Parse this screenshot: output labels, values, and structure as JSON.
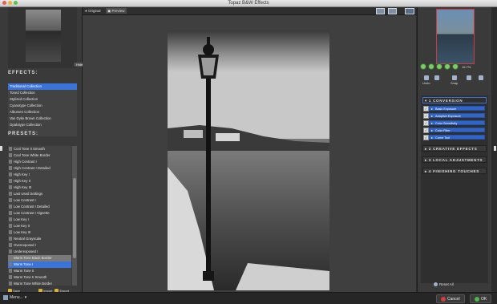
{
  "window": {
    "title": "Topaz B&W Effects"
  },
  "left_panel": {
    "hide_label": "Hide",
    "effects_title": "EFFECTS:",
    "effects": [
      "Traditional Collection",
      "Toned Collection",
      "Stylized Collection",
      "Cyanotype Collection",
      "Albumen Collection",
      "Van Dyke Brown Collection",
      "Opalotype Collection"
    ],
    "selected_effect_index": 0,
    "presets_title": "PRESETS:",
    "presets": [
      "Cool Tone II Smooth",
      "Cool Tone White Border",
      "High Contrast I",
      "High Contrast I Detailed",
      "High Key I",
      "High Key II",
      "High Key III",
      "Last Used Settings",
      "Low Contrast I",
      "Low Contrast I Detailed",
      "Low Contrast I Vignette",
      "Low Key I",
      "Low Key II",
      "Low Key III",
      "Neutral Grayscale",
      "Overexposed I",
      "Underexposed I",
      "Warm Tone Black Border",
      "Warm Tone I",
      "Warm Tone II",
      "Warm Tone II Smooth",
      "Warm Tone White Border"
    ],
    "grey_preset_index": 17,
    "selected_preset_index": 18,
    "bottom_buttons": [
      "Save",
      "Import",
      "Export"
    ]
  },
  "toolbar": {
    "original_label": "Original",
    "preview_label": "Preview"
  },
  "right_panel": {
    "zoom_text": "16.7%",
    "undo_label": "Undo",
    "snap_label": "Snap",
    "sections": [
      {
        "label": "1 CONVERSION",
        "open": true
      },
      {
        "label": "2 CREATIVE EFFECTS",
        "open": false
      },
      {
        "label": "3 LOCAL ADJUSTMENTS",
        "open": false
      },
      {
        "label": "4 FINISHING TOUCHES",
        "open": false
      }
    ],
    "conversion_items": [
      {
        "label": "Basic Exposure",
        "checked": true
      },
      {
        "label": "Adaptive Exposure",
        "checked": true
      },
      {
        "label": "Color Sensitivity",
        "checked": true
      },
      {
        "label": "Color Filter",
        "checked": true
      },
      {
        "label": "Curve Tool",
        "checked": true
      }
    ],
    "reset_label": "Reset All"
  },
  "statusbar": {
    "menu_label": "Menu...",
    "cancel_label": "Cancel",
    "ok_label": "OK"
  }
}
